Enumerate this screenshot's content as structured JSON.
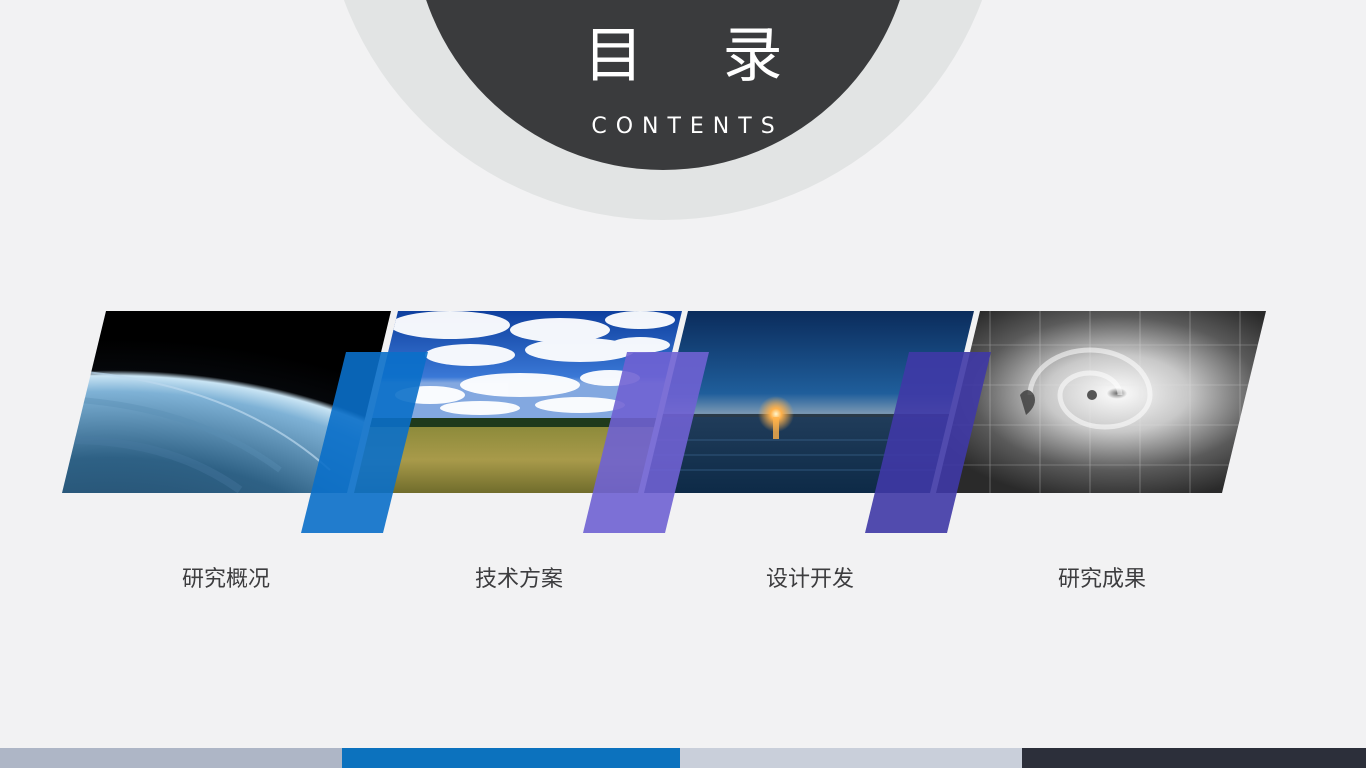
{
  "header": {
    "title": "目 录",
    "subtitle": "CONTENTS"
  },
  "sections": [
    {
      "label": "研究概况",
      "image": "earth-from-space",
      "accent": "#0a6fc9"
    },
    {
      "label": "技术方案",
      "image": "clouds-over-grassland",
      "accent": "#6f62d3"
    },
    {
      "label": "设计开发",
      "image": "sunset-over-lake",
      "accent": "#3f38a6"
    },
    {
      "label": "研究成果",
      "image": "typhoon-satellite-view",
      "accent": ""
    }
  ],
  "footer": {
    "colors": [
      "#aeb6c6",
      "#0c72be",
      "#c9cfda",
      "#2c2f3a"
    ]
  }
}
